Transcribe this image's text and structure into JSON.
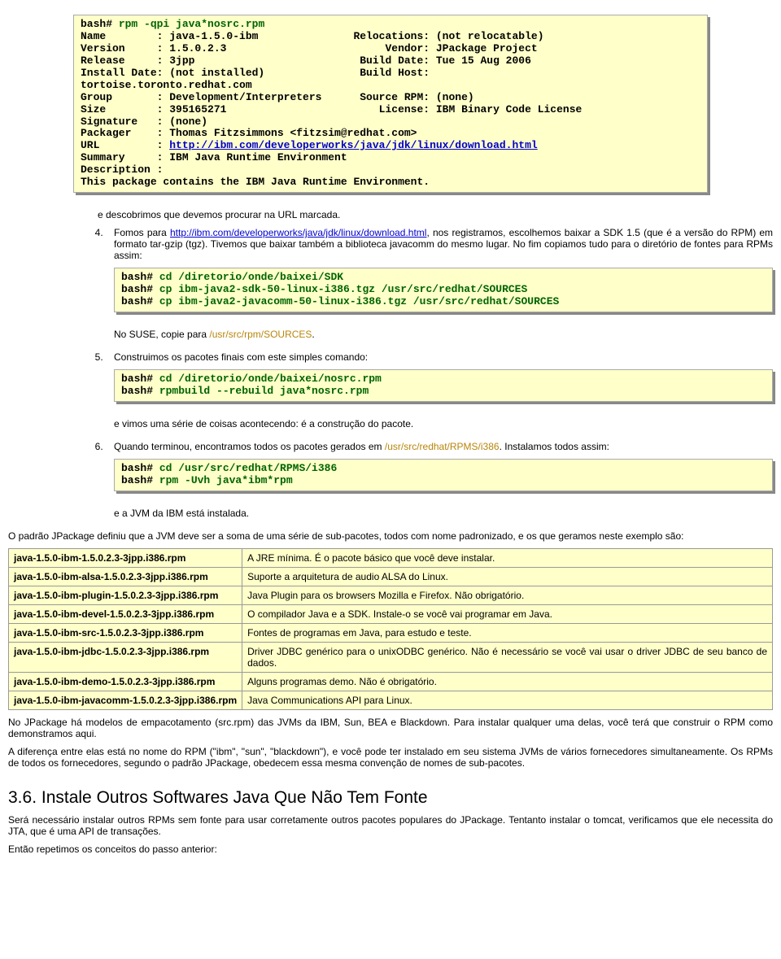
{
  "step3": {
    "tail": "e descobrimos que devemos procurar na URL marcada."
  },
  "step4": {
    "intro_pre": "Fomos para ",
    "link_text": "http://ibm.com/developerworks/java/jdk/linux/download.html",
    "intro_post": ", nos registramos, escolhemos baixar a SDK 1.5 (que é a versão do RPM) em formato tar-gzip (tgz). Tivemos que baixar também a biblioteca javacomm do mesmo lugar. No fim copiamos tudo para o diretório de fontes para RPMs assim:",
    "tail_pre": "No SUSE, copie para ",
    "tail_path": "/usr/src/rpm/SOURCES",
    "tail_post": "."
  },
  "step5": {
    "intro": "Construimos os pacotes finais com este simples comando:",
    "tail": "e vimos uma série de coisas acontecendo: é a construção do pacote."
  },
  "step6": {
    "intro_pre": "Quando terminou, encontramos todos os pacotes gerados em ",
    "intro_path": "/usr/src/redhat/RPMS/i386",
    "intro_post": ". Instalamos todos assim:",
    "tail": "e a JVM da IBM está instalada."
  },
  "packages_intro": "O padrão JPackage definiu que a JVM deve ser a soma de uma série de sub-pacotes, todos com nome padronizado, e os que geramos neste exemplo são:",
  "packages": [
    {
      "name": "java-1.5.0-ibm-1.5.0.2.3-3jpp.i386.rpm",
      "desc": "A JRE mínima. É o pacote básico que você deve instalar."
    },
    {
      "name": "java-1.5.0-ibm-alsa-1.5.0.2.3-3jpp.i386.rpm",
      "desc": "Suporte a arquitetura de audio ALSA do Linux."
    },
    {
      "name": "java-1.5.0-ibm-plugin-1.5.0.2.3-3jpp.i386.rpm",
      "desc": "Java Plugin para os browsers Mozilla e Firefox. Não obrigatório."
    },
    {
      "name": "java-1.5.0-ibm-devel-1.5.0.2.3-3jpp.i386.rpm",
      "desc": "O compilador Java e a SDK. Instale-o se você vai programar em Java."
    },
    {
      "name": "java-1.5.0-ibm-src-1.5.0.2.3-3jpp.i386.rpm",
      "desc": "Fontes de programas em Java, para estudo e teste."
    },
    {
      "name": "java-1.5.0-ibm-jdbc-1.5.0.2.3-3jpp.i386.rpm",
      "desc": "Driver JDBC genérico para o unixODBC genérico. Não é necessário se você vai usar o driver JDBC de seu banco de dados."
    },
    {
      "name": "java-1.5.0-ibm-demo-1.5.0.2.3-3jpp.i386.rpm",
      "desc": "Alguns programas demo. Não é obrigatório."
    },
    {
      "name": "java-1.5.0-ibm-javacomm-1.5.0.2.3-3jpp.i386.rpm",
      "desc": "Java Communications API para Linux."
    }
  ],
  "footer": {
    "p1": "No JPackage há modelos de empacotamento (src.rpm) das JVMs da IBM, Sun, BEA e Blackdown. Para instalar qualquer uma delas, você terá que construir o RPM como demonstramos aqui.",
    "p2": "A diferença entre elas está no nome do RPM (\"ibm\", \"sun\", \"blackdown\"), e você pode ter instalado em seu sistema JVMs de vários fornecedores simultaneamente. Os RPMs de todos os fornecedores, segundo o padrão JPackage, obedecem essa mesma convenção de nomes de sub-pacotes."
  },
  "section36": {
    "title": "3.6. Instale Outros Softwares Java Que Não Tem Fonte",
    "p1": "Será necessário instalar outros RPMs sem fonte para usar corretamente outros pacotes populares do JPackage. Tentanto instalar o tomcat, verificamos que ele necessita do JTA, que é uma API de transações.",
    "p2": "Então repetimos os conceitos do passo anterior:"
  }
}
